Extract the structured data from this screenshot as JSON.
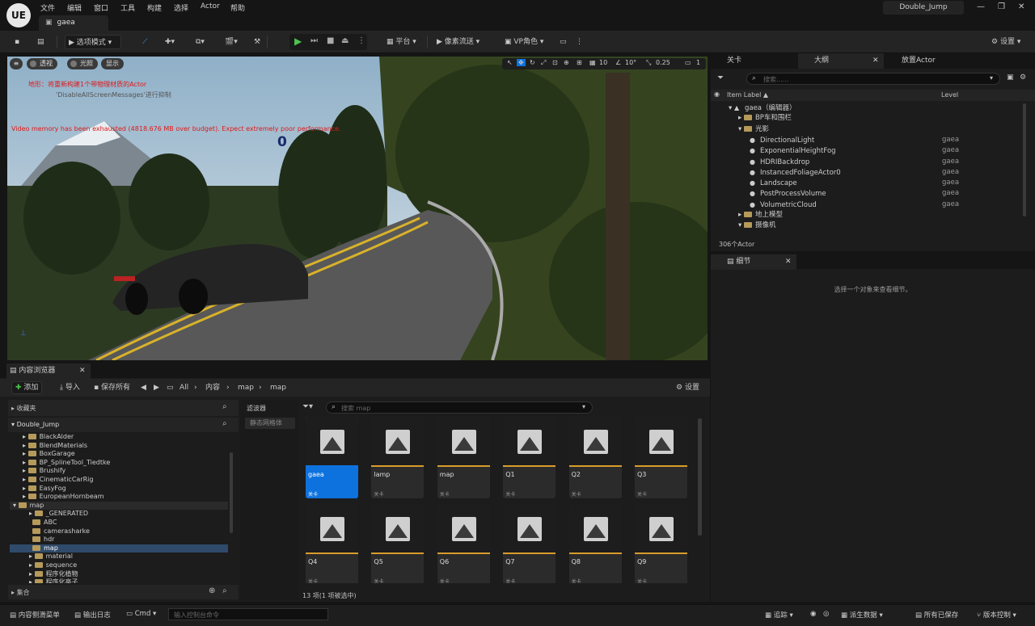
{
  "app": {
    "logo": "UE",
    "project": "Double_Jump",
    "level_tab": "gaea"
  },
  "menu": [
    "文件",
    "编辑",
    "窗口",
    "工具",
    "构建",
    "选择",
    "Actor",
    "帮助"
  ],
  "toolbar": {
    "mode": "选项模式",
    "platform": "平台",
    "pixel_stream": "像素流送",
    "vp_role": "VP角色",
    "settings": "设置"
  },
  "viewport": {
    "buttons": [
      "透视",
      "光照",
      "显示"
    ],
    "grid": "10",
    "rot": "10°",
    "scale": "0.25",
    "cam": "1",
    "msg1": "地形：将重新构建1个带物理材质的Actor",
    "msg2": "'DisableAllScreenMessages'进行抑制",
    "msg3": "Video memory has been exhausted (4818.676 MB over budget). Expect extremely poor performance.",
    "counter": "0"
  },
  "outliner": {
    "tabs": [
      "关卡",
      "大纲",
      "放置Actor"
    ],
    "search_placeholder": "搜索......",
    "col_label": "Item Label ▲",
    "col_level": "Level",
    "rows": [
      {
        "label": "gaea（编辑器）",
        "level": "",
        "kind": "root"
      },
      {
        "label": "BP车和围栏",
        "level": "",
        "kind": "folder"
      },
      {
        "label": "光影",
        "level": "",
        "kind": "folder-open"
      },
      {
        "label": "DirectionalLight",
        "level": "gaea",
        "kind": "actor"
      },
      {
        "label": "ExponentialHeightFog",
        "level": "gaea",
        "kind": "actor"
      },
      {
        "label": "HDRIBackdrop",
        "level": "gaea",
        "kind": "actor"
      },
      {
        "label": "InstancedFoliageActor0",
        "level": "gaea",
        "kind": "actor"
      },
      {
        "label": "Landscape",
        "level": "gaea",
        "kind": "actor"
      },
      {
        "label": "PostProcessVolume",
        "level": "gaea",
        "kind": "actor"
      },
      {
        "label": "VolumetricCloud",
        "level": "gaea",
        "kind": "actor"
      },
      {
        "label": "地上模型",
        "level": "",
        "kind": "folder"
      },
      {
        "label": "摄像机",
        "level": "",
        "kind": "folder-open"
      }
    ],
    "count": "306个Actor"
  },
  "details": {
    "tab": "细节",
    "empty": "选择一个对象来查看细节。"
  },
  "content_browser": {
    "tab": "内容浏览器",
    "add": "添加",
    "import": "导入",
    "save_all": "保存所有",
    "path": [
      "All",
      "内容",
      "map",
      "map"
    ],
    "settings": "设置",
    "favorites": "收藏夹",
    "project": "Double_Jump",
    "tree": [
      "BlackAlder",
      "BlendMaterials",
      "BoxGarage",
      "BP_SplineTool_Tiedtke",
      "Brushify",
      "CinematicCarRig",
      "EasyFog",
      "EuropeanHornbeam",
      "map",
      "_GENERATED",
      "ABC",
      "camerasharke",
      "hdr",
      "map",
      "material",
      "sequence",
      "程序化植物",
      "程序化亭子"
    ],
    "collections": "集合",
    "filters": "滤波器",
    "filter_item": "静态网格体",
    "search_placeholder": "搜索 map",
    "assets": [
      {
        "name": "gaea",
        "type": "关卡"
      },
      {
        "name": "lamp",
        "type": "关卡"
      },
      {
        "name": "map",
        "type": "关卡"
      },
      {
        "name": "Q1",
        "type": "关卡"
      },
      {
        "name": "Q2",
        "type": "关卡"
      },
      {
        "name": "Q3",
        "type": "关卡"
      },
      {
        "name": "Q4",
        "type": "关卡"
      },
      {
        "name": "Q5",
        "type": "关卡"
      },
      {
        "name": "Q6",
        "type": "关卡"
      },
      {
        "name": "Q7",
        "type": "关卡"
      },
      {
        "name": "Q8",
        "type": "关卡"
      },
      {
        "name": "Q9",
        "type": "关卡"
      }
    ],
    "status": "13 项(1 项被选中)"
  },
  "statusbar": {
    "drawer": "内容侧滑菜单",
    "log": "输出日志",
    "cmd": "Cmd",
    "cmd_placeholder": "输入控制台命令",
    "trace": "追踪",
    "derived": "派生数据",
    "saved": "所有已保存",
    "vcs": "版本控制"
  }
}
